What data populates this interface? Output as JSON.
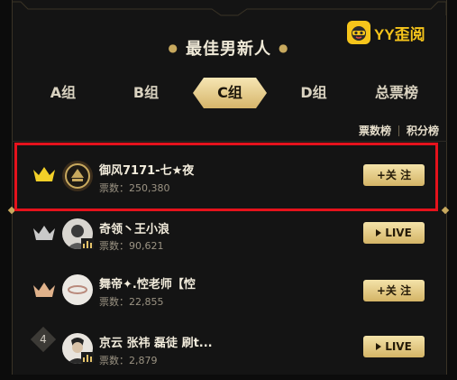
{
  "header": {
    "title": "最佳男新人",
    "badge_text": "YY歪阅"
  },
  "tabs": [
    {
      "label": "A组",
      "active": false
    },
    {
      "label": "B组",
      "active": false
    },
    {
      "label": "C组",
      "active": true
    },
    {
      "label": "D组",
      "active": false
    },
    {
      "label": "总票榜",
      "active": false
    }
  ],
  "links": {
    "votes_rank": "票数榜",
    "points_rank": "积分榜"
  },
  "rows": [
    {
      "rank_icon": "gold-crown-icon",
      "name": "御风7171-七★夜",
      "votes": "票数：250,380",
      "button": "+关 注",
      "button_type": "follow"
    },
    {
      "rank_icon": "silver-crown-icon",
      "name": "奇领丶王小浪",
      "votes": "票数：90,621",
      "button": "LIVE",
      "button_type": "live"
    },
    {
      "rank_icon": "bronze-crown-icon",
      "name": "舞帝✦.悾老师【悾",
      "votes": "票数：22,855",
      "button": "+关 注",
      "button_type": "follow"
    },
    {
      "rank_num": "4",
      "name": "京云 张祎 磊徒 刷t...",
      "votes": "票数：2,879",
      "button": "LIVE",
      "button_type": "live"
    }
  ],
  "colors": {
    "accent_gold": "#d6b56a",
    "highlight_red": "#e5121c",
    "background": "#141414"
  }
}
